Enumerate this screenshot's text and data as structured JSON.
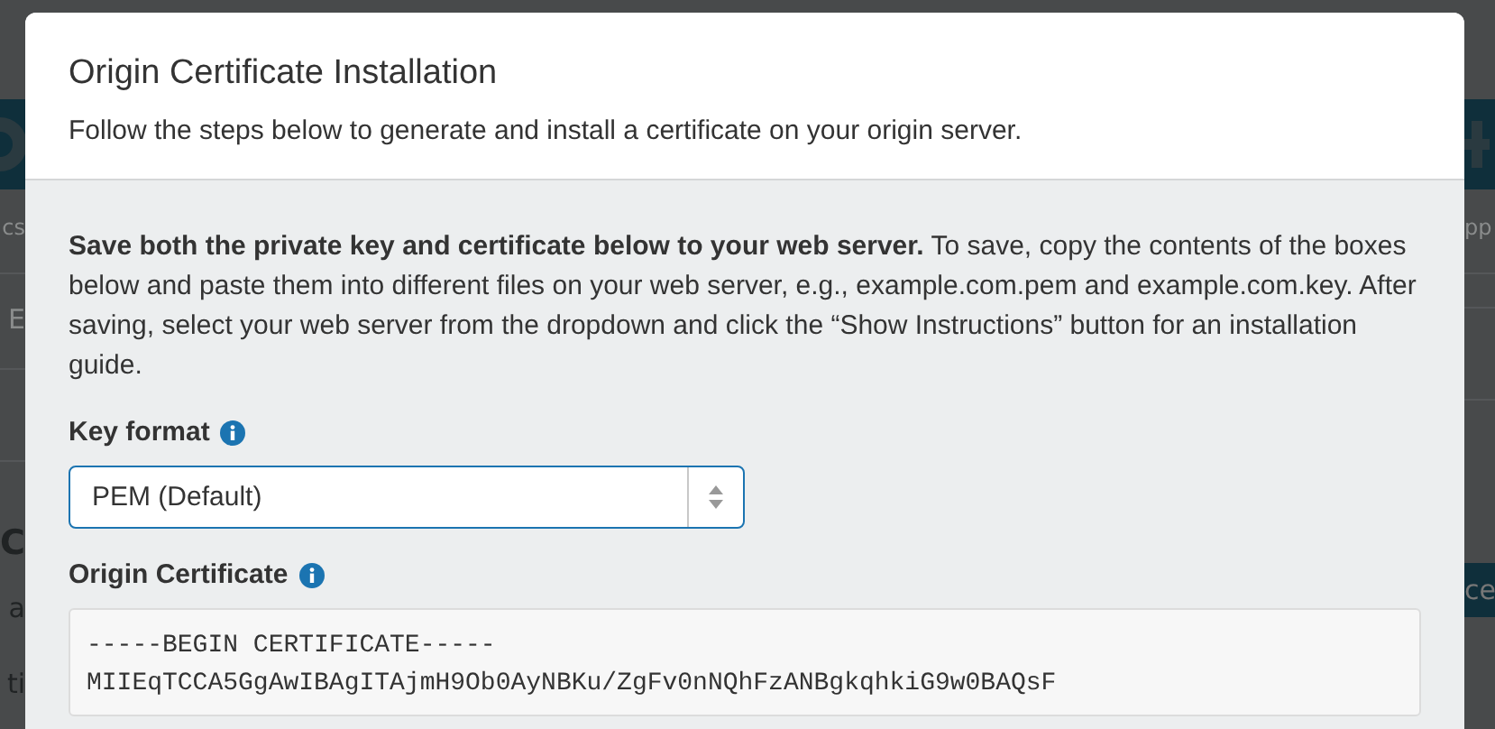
{
  "backdrop": {
    "left_texts": [
      "cs",
      "E",
      "C",
      "a",
      "ti"
    ],
    "right_texts": [
      "pp"
    ],
    "right_button": "ce"
  },
  "modal": {
    "title": "Origin Certificate Installation",
    "subtitle": "Follow the steps below to generate and install a certificate on your origin server.",
    "intro": "**Save both the private key and certificate below to your web server.** To save, copy the contents of the boxes below and paste them into different files on your web server, e.g., example.com.pem and example.com.key. After saving, select your web server from the dropdown and click the “Show Instructions” button for an installation guide.",
    "key_format": {
      "label": "Key format",
      "value": "PEM (Default)"
    },
    "certificate": {
      "label": "Origin Certificate",
      "lines": [
        "-----BEGIN CERTIFICATE-----",
        "MIIEqTCCA5GgAwIBAgITAjmH9Ob0AyNBKu/ZgFv0nNQhFzANBgkqhkiG9w0BAQsF"
      ]
    }
  }
}
